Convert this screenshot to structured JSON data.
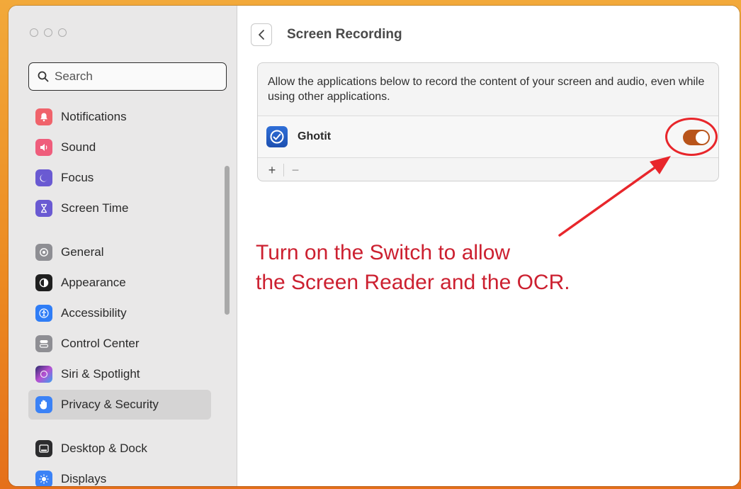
{
  "search": {
    "placeholder": "Search"
  },
  "sidebar": {
    "items": [
      {
        "label": "Notifications",
        "icon": "bell-icon",
        "color": "#f0636b"
      },
      {
        "label": "Sound",
        "icon": "speaker-icon",
        "color": "#ef5d7c"
      },
      {
        "label": "Focus",
        "icon": "moon-icon",
        "color": "#6a5ad2"
      },
      {
        "label": "Screen Time",
        "icon": "hourglass-icon",
        "color": "#6a5ad2"
      },
      {
        "label": "General",
        "icon": "gear-icon",
        "color": "#8e8e93"
      },
      {
        "label": "Appearance",
        "icon": "appearance-icon",
        "color": "#1f1f1f"
      },
      {
        "label": "Accessibility",
        "icon": "accessibility-icon",
        "color": "#2f7df6"
      },
      {
        "label": "Control Center",
        "icon": "toggles-icon",
        "color": "#8e8e93"
      },
      {
        "label": "Siri & Spotlight",
        "icon": "siri-icon",
        "color": "#7a5ad8"
      },
      {
        "label": "Privacy & Security",
        "icon": "hand-icon",
        "color": "#3b82f6",
        "selected": true
      },
      {
        "label": "Desktop & Dock",
        "icon": "dock-icon",
        "color": "#2c2c2e"
      },
      {
        "label": "Displays",
        "icon": "sun-icon",
        "color": "#3b82f6"
      }
    ]
  },
  "header": {
    "title": "Screen Recording",
    "back_icon": "chevron-left-icon"
  },
  "panel": {
    "description": "Allow the applications below to record the content of your screen and audio, even while using other applications.",
    "apps": [
      {
        "name": "Ghotit",
        "icon": "ghotit-app-icon",
        "enabled": true
      }
    ],
    "add_label": "+",
    "remove_label": "−"
  },
  "annotation": {
    "line1": "Turn on the Switch to allow",
    "line2": "the Screen Reader and the OCR.",
    "color": "#cc2030"
  },
  "colors": {
    "toggle_on": "#b8541a",
    "highlight": "#e8262b",
    "selection": "#d5d4d4"
  }
}
